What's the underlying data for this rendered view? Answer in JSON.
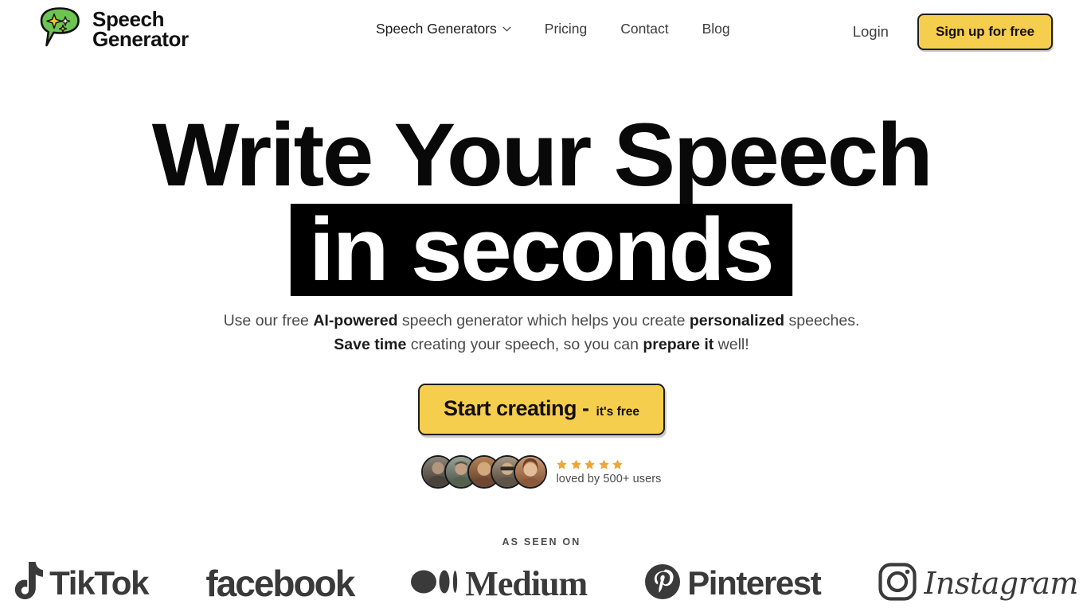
{
  "brand": {
    "line1": "Speech",
    "line2": "Generator",
    "icon": "speech-bubble-sparkle-logo",
    "bubble_color": "#6CC551",
    "sparkle_color": "#F3C32C"
  },
  "nav": {
    "items": [
      {
        "label": "Speech Generators",
        "has_dropdown": true,
        "icon": "chevron-down-icon"
      },
      {
        "label": "Pricing",
        "has_dropdown": false
      },
      {
        "label": "Contact",
        "has_dropdown": false
      },
      {
        "label": "Blog",
        "has_dropdown": false
      }
    ]
  },
  "auth": {
    "login_label": "Login",
    "signup_label": "Sign up for free",
    "signup_bg": "#F6CE4E",
    "signup_border": "#1d1d1d"
  },
  "hero": {
    "heading_line1": "Write Your Speech",
    "heading_line2_highlight": "in seconds",
    "highlight_bg": "#000000",
    "highlight_color": "#ffffff",
    "subtitle": {
      "line1_parts": [
        {
          "text": "Use our free ",
          "bold": false
        },
        {
          "text": "AI-powered",
          "bold": true
        },
        {
          "text": " speech generator which helps you create ",
          "bold": false
        },
        {
          "text": "personalized",
          "bold": true
        },
        {
          "text": " speeches.",
          "bold": false
        }
      ],
      "line2_parts": [
        {
          "text": "Save time",
          "bold": true
        },
        {
          "text": " creating your speech, so you can ",
          "bold": false
        },
        {
          "text": "prepare it",
          "bold": true
        },
        {
          "text": " well!",
          "bold": false
        }
      ]
    },
    "cta": {
      "main_label": "Start creating -",
      "sub_label": "it's free",
      "bg": "#F6CE4E"
    }
  },
  "social_proof": {
    "avatar_count": 5,
    "avatars": [
      {
        "name": "avatar-user-1",
        "colors": [
          "#6b6257",
          "#3e3a33"
        ]
      },
      {
        "name": "avatar-user-2",
        "colors": [
          "#7e8a7c",
          "#474d44"
        ]
      },
      {
        "name": "avatar-user-3",
        "colors": [
          "#9c6a4a",
          "#5a3a26"
        ]
      },
      {
        "name": "avatar-user-4",
        "colors": [
          "#8e7f6a",
          "#4d4236"
        ]
      },
      {
        "name": "avatar-user-5",
        "colors": [
          "#c08a63",
          "#7a4f33"
        ]
      }
    ],
    "star_count": 5,
    "star_color": "#EFA53A",
    "text": "loved by 500+ users"
  },
  "as_seen_on": {
    "label": "AS SEEN ON",
    "logos": [
      {
        "name": "tiktok-logo",
        "word": "TikTok"
      },
      {
        "name": "facebook-logo",
        "word": "facebook"
      },
      {
        "name": "medium-logo",
        "word": "Medium"
      },
      {
        "name": "pinterest-logo",
        "word": "Pinterest"
      },
      {
        "name": "instagram-logo",
        "word": "Instagram"
      }
    ]
  }
}
